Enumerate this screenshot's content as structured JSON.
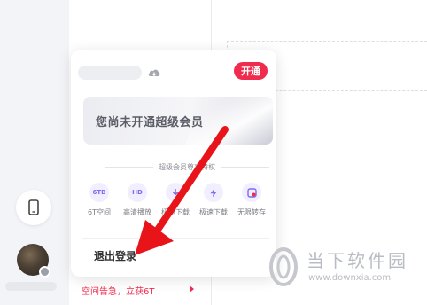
{
  "sidebar": {
    "device_icon": "phone-icon"
  },
  "account_card": {
    "open_button_label": "开通",
    "vip_banner_text": "您尚未开通超级会员",
    "perks_title": "超级会员尊享特权",
    "perks": [
      {
        "icon_text": "6TB",
        "label": "6T空间"
      },
      {
        "icon_text": "HD",
        "label": "高清播放"
      },
      {
        "icon_text": "",
        "label": "极速下载"
      },
      {
        "icon_text": "",
        "label": "极速下载"
      },
      {
        "icon_text": "",
        "label": "无限转存"
      }
    ],
    "logout_label": "退出登录"
  },
  "promo": {
    "text": "空间告急，立获6T"
  },
  "watermark": {
    "title": "当下软件园",
    "url": "www.downxia.com"
  },
  "colors": {
    "accent": "#ef2c4e",
    "annotation_arrow": "#e8141a",
    "perk_icon": "#7b6cf0"
  }
}
